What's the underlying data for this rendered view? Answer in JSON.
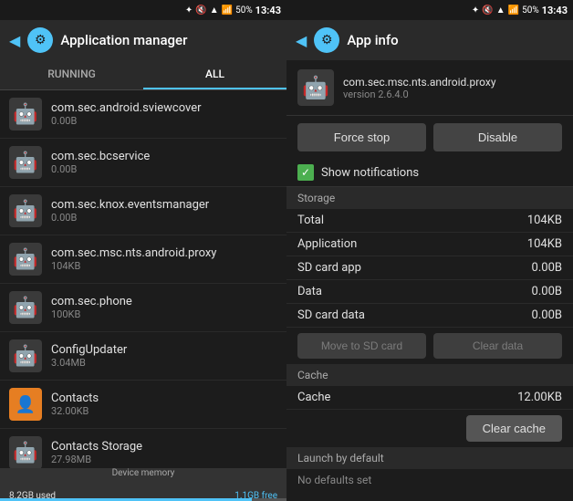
{
  "statusBar": {
    "time": "13:43",
    "battery": "50%",
    "icons": "bluetooth wifi signal"
  },
  "leftPanel": {
    "title": "Application manager",
    "backIcon": "◀",
    "gearIcon": "⚙",
    "tabs": [
      {
        "label": "RUNNING",
        "active": false
      },
      {
        "label": "ALL",
        "active": true
      }
    ],
    "apps": [
      {
        "name": "com.sec.android.sviewcover",
        "size": "0.00B",
        "iconType": "android"
      },
      {
        "name": "com.sec.bcservice",
        "size": "0.00B",
        "iconType": "android"
      },
      {
        "name": "com.sec.knox.eventsmanager",
        "size": "0.00B",
        "iconType": "android"
      },
      {
        "name": "com.sec.msc.nts.android.proxy",
        "size": "104KB",
        "iconType": "android"
      },
      {
        "name": "com.sec.phone",
        "size": "100KB",
        "iconType": "android"
      },
      {
        "name": "ConfigUpdater",
        "size": "3.04MB",
        "iconType": "android"
      },
      {
        "name": "Contacts",
        "size": "32.00KB",
        "iconType": "contacts"
      },
      {
        "name": "Contacts Storage",
        "size": "27.98MB",
        "iconType": "android"
      }
    ],
    "storageBar": {
      "used": "8.2GB used",
      "free": "1.1GB free",
      "label": "Device memory"
    }
  },
  "rightPanel": {
    "title": "App info",
    "backIcon": "◀",
    "gearIcon": "⚙",
    "app": {
      "package": "com.sec.msc.nts.android.proxy",
      "version": "version 2.6.4.0",
      "iconType": "android"
    },
    "buttons": {
      "forceStop": "Force stop",
      "disable": "Disable"
    },
    "showNotifications": {
      "label": "Show notifications",
      "checked": true
    },
    "storageSectionLabel": "Storage",
    "storageRows": [
      {
        "label": "Total",
        "value": "104KB"
      },
      {
        "label": "Application",
        "value": "104KB"
      },
      {
        "label": "SD card app",
        "value": "0.00B"
      },
      {
        "label": "Data",
        "value": "0.00B"
      },
      {
        "label": "SD card data",
        "value": "0.00B"
      }
    ],
    "sdButtons": {
      "moveToSD": "Move to SD card",
      "clearData": "Clear data"
    },
    "cacheSectionLabel": "Cache",
    "cacheRows": [
      {
        "label": "Cache",
        "value": "12.00KB"
      }
    ],
    "clearCacheButton": "Clear cache",
    "launchSectionLabel": "Launch by default",
    "launchText": "No defaults set"
  }
}
